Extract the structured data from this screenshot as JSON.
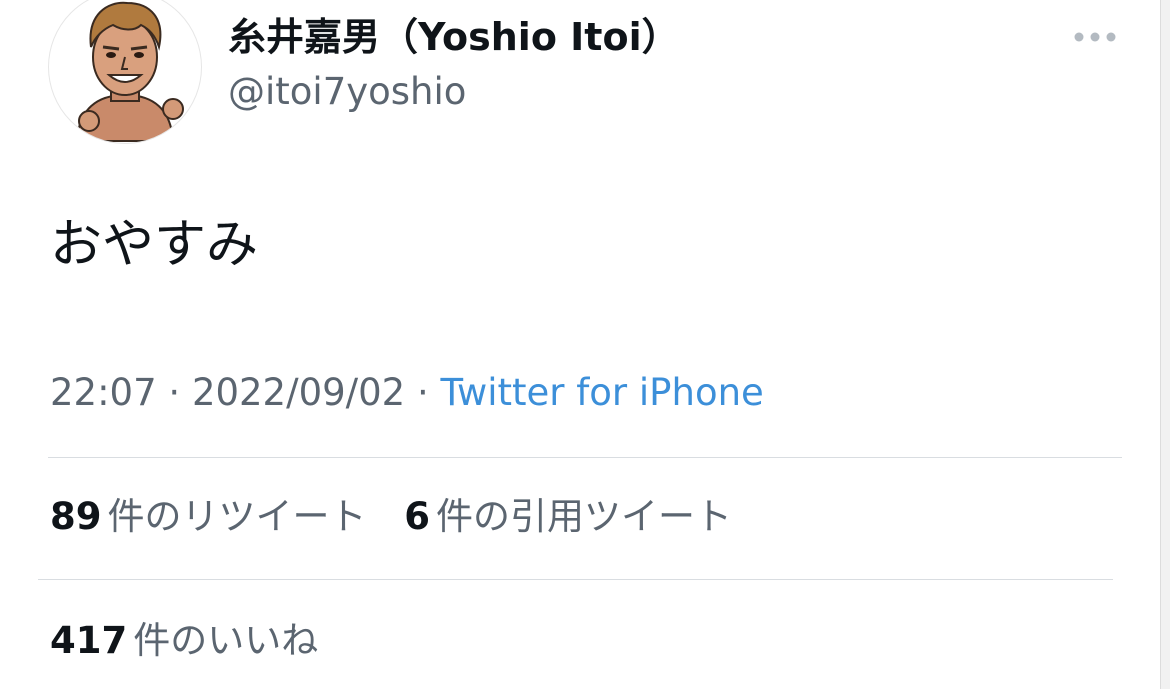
{
  "user": {
    "display_name": "糸井嘉男（Yoshio Itoi）",
    "handle": "@itoi7yoshio"
  },
  "tweet": {
    "text": "おやすみ",
    "time": "22:07",
    "separator": "·",
    "date": "2022/09/02",
    "source": "Twitter for iPhone"
  },
  "stats": {
    "retweets": {
      "count": "89",
      "label": "件のリツイート"
    },
    "quotes": {
      "count": "6",
      "label": "件の引用ツイート"
    },
    "likes": {
      "count": "417",
      "label": "件のいいね"
    }
  },
  "icons": {
    "more": "more-horizontal-icon",
    "avatar": "avatar-illustration"
  },
  "colors": {
    "text_primary": "#0f1419",
    "text_secondary": "#5b6570",
    "link": "#3c8fd9",
    "divider": "#d9dde1"
  }
}
